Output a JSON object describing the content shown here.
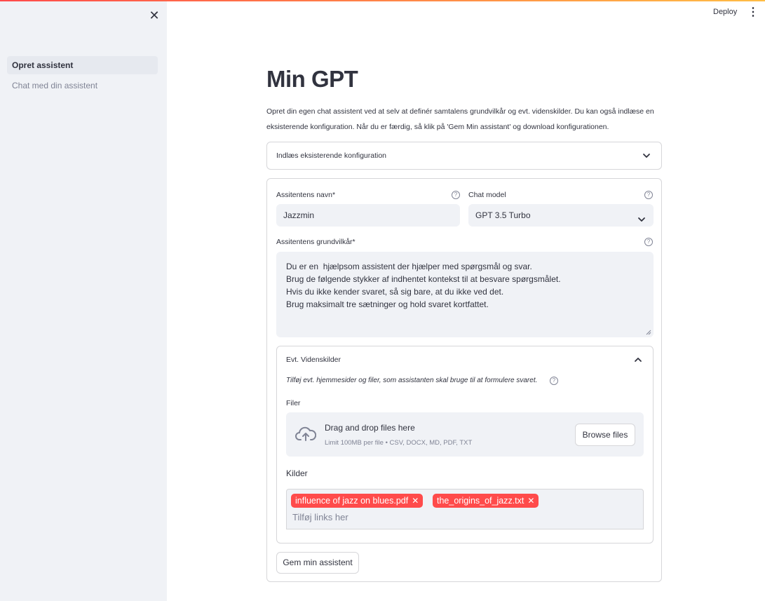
{
  "sidebar": {
    "close_icon": "close-icon",
    "items": [
      {
        "label": "Opret assistent",
        "active": true
      },
      {
        "label": "Chat med din assistent",
        "active": false
      }
    ]
  },
  "header": {
    "deploy_label": "Deploy",
    "menu_icon": "kebab-menu-icon"
  },
  "main": {
    "title": "Min GPT",
    "intro_line1": "Opret din egen chat assistent ved at selv at definér samtalens grundvilkår og evt. videnskilder. Du kan også indlæse en",
    "intro_line2": "eksisterende konfiguration. Når du er færdig, så klik på 'Gem Min assistant' og download konfigurationen.",
    "load_expander_label": "Indlæs eksisterende konfiguration",
    "form": {
      "name_label": "Assitentens navn*",
      "name_value": "Jazzmin",
      "model_label": "Chat model",
      "model_value": "GPT 3.5 Turbo",
      "rules_label": "Assitentens grundvilkår*",
      "rules_lines": [
        "Du er en  hjælpsom assistent der hjælper med spørgsmål og svar.",
        "Brug de følgende stykker af indhentet kontekst til at besvare spørgsmålet.",
        "Hvis du ikke kender svaret, så sig bare, at du ikke ved det.",
        "Brug maksimalt tre sætninger og hold svaret kortfattet."
      ],
      "sources_expander_label": "Evt. Videnskilder",
      "sources_caption": "Tilføj evt. hjemmesider og filer, som assistanten skal bruge til at formulere svaret.",
      "files_label": "Filer",
      "dropzone_title": "Drag and drop files here",
      "dropzone_sub": "Limit 100MB per file • CSV, DOCX, MD, PDF, TXT",
      "browse_label": "Browse files",
      "kilder_label": "Kilder",
      "tags": [
        "influence of jazz on blues.pdf",
        "the_origins_of_jazz.txt"
      ],
      "links_placeholder": "Tilføj links her",
      "save_label": "Gem min assistent"
    }
  },
  "colors": {
    "accent": "#ff4b4b",
    "sidebar_bg": "#f0f2f6",
    "text": "#31333f",
    "muted": "#808495"
  }
}
